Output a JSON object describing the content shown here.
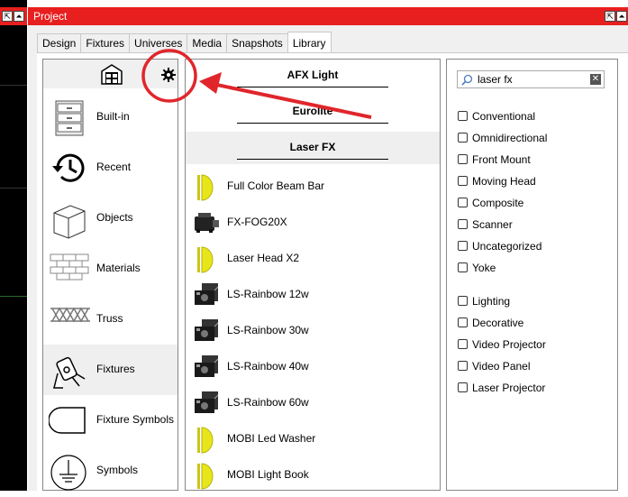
{
  "window": {
    "title": "Project",
    "max_icon": "maximize-icon",
    "restore_icon": "restore-icon"
  },
  "tabs": [
    {
      "label": "Design"
    },
    {
      "label": "Fixtures"
    },
    {
      "label": "Universes"
    },
    {
      "label": "Media"
    },
    {
      "label": "Snapshots"
    },
    {
      "label": "Library",
      "active": true
    }
  ],
  "categories": [
    {
      "label": "Built-in",
      "icon": "drawer-cabinet-icon"
    },
    {
      "label": "Recent",
      "icon": "history-clock-icon"
    },
    {
      "label": "Objects",
      "icon": "cube-icon"
    },
    {
      "label": "Materials",
      "icon": "brick-wall-icon"
    },
    {
      "label": "Truss",
      "icon": "truss-icon"
    },
    {
      "label": "Fixtures",
      "icon": "spotlight-icon",
      "active": true
    },
    {
      "label": "Fixture Symbols",
      "icon": "fixture-symbol-icon"
    },
    {
      "label": "Symbols",
      "icon": "ground-symbol-icon"
    }
  ],
  "category_header": {
    "warehouse_icon": "warehouse-icon",
    "settings_icon": "gear-icon"
  },
  "manufacturers": [
    {
      "label": "AFX Light"
    },
    {
      "label": "Eurolite"
    },
    {
      "label": "Laser FX",
      "active": true
    }
  ],
  "fixtures": [
    {
      "label": "Full Color Beam Bar",
      "icon": "yellow-fixture-icon"
    },
    {
      "label": "FX-FOG20X",
      "icon": "fog-machine-icon"
    },
    {
      "label": "Laser Head X2",
      "icon": "yellow-fixture-icon"
    },
    {
      "label": "LS-Rainbow 12w",
      "icon": "laser-projector-icon"
    },
    {
      "label": "LS-Rainbow 30w",
      "icon": "laser-projector-icon"
    },
    {
      "label": "LS-Rainbow 40w",
      "icon": "laser-projector-icon"
    },
    {
      "label": "LS-Rainbow 60w",
      "icon": "laser-projector-icon"
    },
    {
      "label": "MOBI Led Washer",
      "icon": "yellow-fixture-icon"
    },
    {
      "label": "MOBI Light Book",
      "icon": "yellow-fixture-icon"
    }
  ],
  "search": {
    "value": "laser fx",
    "icon": "search-icon",
    "clear_icon": "close-icon"
  },
  "filters_type": [
    {
      "label": "Conventional"
    },
    {
      "label": "Omnidirectional"
    },
    {
      "label": "Front Mount"
    },
    {
      "label": "Moving Head"
    },
    {
      "label": "Composite"
    },
    {
      "label": "Scanner"
    },
    {
      "label": "Uncategorized"
    },
    {
      "label": "Yoke"
    }
  ],
  "filters_kind": [
    {
      "label": "Lighting"
    },
    {
      "label": "Decorative"
    },
    {
      "label": "Video Projector"
    },
    {
      "label": "Video Panel"
    },
    {
      "label": "Laser Projector"
    }
  ],
  "colors": {
    "titlebar": "#e81f1f",
    "annotation": "#e0262b",
    "fixture_yellow": "#e8e61a"
  }
}
